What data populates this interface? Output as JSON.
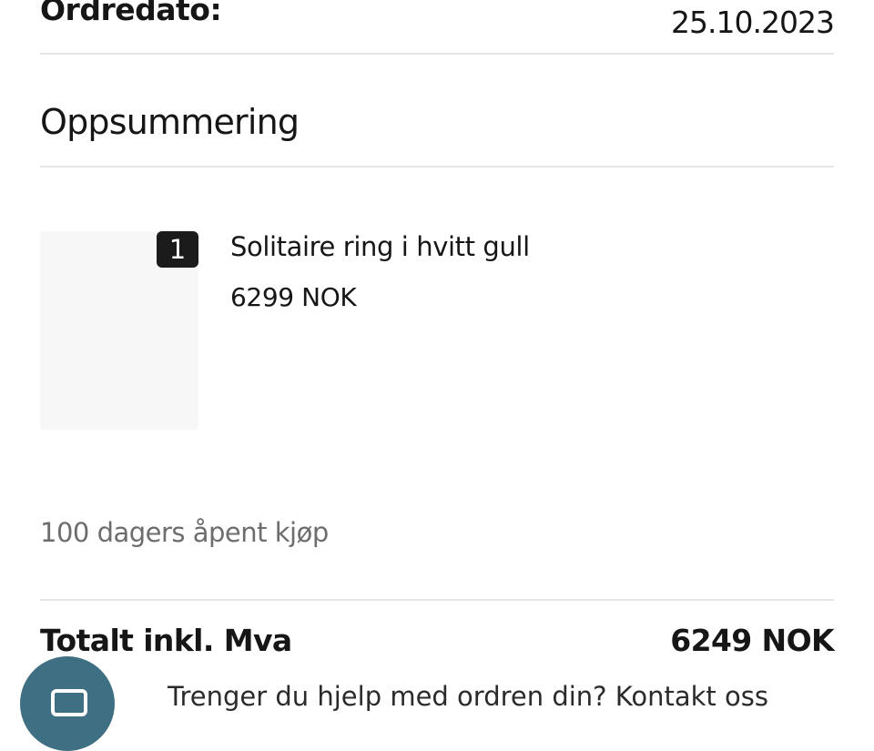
{
  "order": {
    "date_label": "Ordredato:",
    "date_value": "25.10.2023"
  },
  "summary": {
    "title": "Oppsummering"
  },
  "items": [
    {
      "quantity": "1",
      "name": "Solitaire ring i hvitt gull",
      "price": "6299 NOK"
    }
  ],
  "policy": {
    "open_purchase": "100 dagers åpent kjøp"
  },
  "totals": {
    "label": "Totalt inkl. Mva",
    "value": "6249 NOK"
  },
  "footer": {
    "partial_text": "Trenger du hjelp med ordren din? Kontakt oss"
  },
  "icons": {
    "chat": "chat-icon"
  }
}
